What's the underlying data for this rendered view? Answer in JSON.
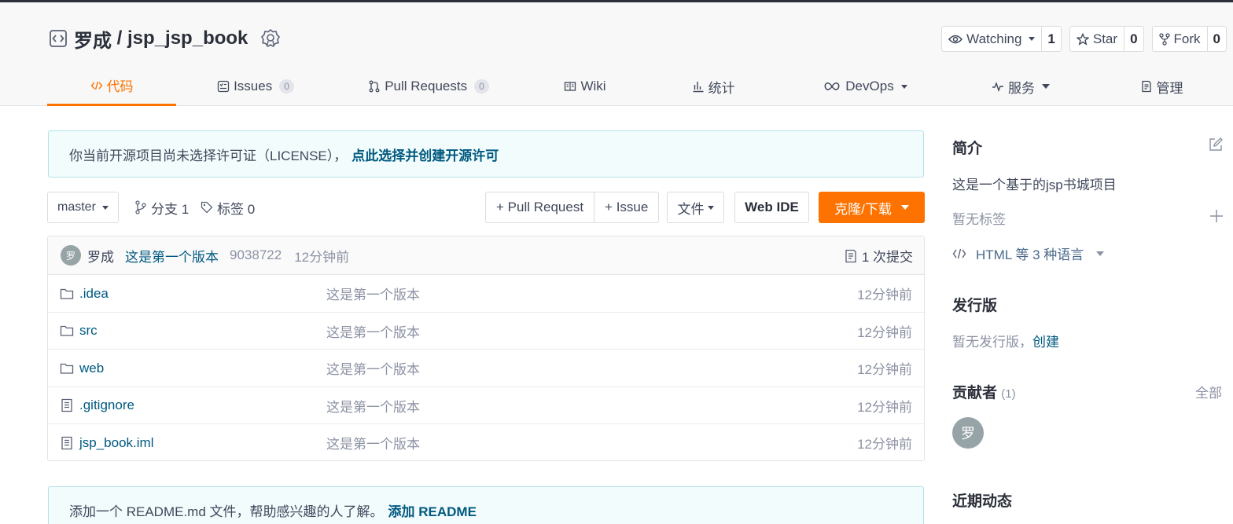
{
  "repo": {
    "owner": "罗成",
    "separator": " / ",
    "name": "jsp_jsp_book"
  },
  "header_buttons": [
    {
      "label": "Watching",
      "count": "1"
    },
    {
      "label": "Star",
      "count": "0"
    },
    {
      "label": "Fork",
      "count": "0"
    }
  ],
  "tabs": [
    {
      "label": "代码",
      "active": true
    },
    {
      "label": "Issues",
      "count": "0"
    },
    {
      "label": "Pull Requests",
      "count": "0"
    },
    {
      "label": "Wiki"
    },
    {
      "label": "统计"
    },
    {
      "label": "DevOps"
    },
    {
      "label": "服务"
    },
    {
      "label": "管理"
    }
  ],
  "license_notice": {
    "text": "你当前开源项目尚未选择许可证（LICENSE），",
    "link": "点此选择并创建开源许可"
  },
  "toolbar": {
    "branch": "master",
    "branches_label": "分支 1",
    "tags_label": "标签 0",
    "pull_request": "+ Pull Request",
    "issue": "+ Issue",
    "file": "文件",
    "web_ide": "Web IDE",
    "clone": "克隆/下载"
  },
  "commit": {
    "avatar": "罗",
    "author": "罗成",
    "message": "这是第一个版本",
    "sha": "9038722",
    "time": "12分钟前",
    "count_label": "1 次提交"
  },
  "files": [
    {
      "name": ".idea",
      "type": "folder",
      "message": "这是第一个版本",
      "time": "12分钟前"
    },
    {
      "name": "src",
      "type": "folder",
      "message": "这是第一个版本",
      "time": "12分钟前"
    },
    {
      "name": "web",
      "type": "folder",
      "message": "这是第一个版本",
      "time": "12分钟前"
    },
    {
      "name": ".gitignore",
      "type": "file",
      "message": "这是第一个版本",
      "time": "12分钟前"
    },
    {
      "name": "jsp_book.iml",
      "type": "file",
      "message": "这是第一个版本",
      "time": "12分钟前"
    }
  ],
  "readme_notice": {
    "text": "添加一个 README.md 文件，帮助感兴趣的人了解。",
    "link": "添加 README"
  },
  "sidebar": {
    "intro_title": "简介",
    "description": "这是一个基于的jsp书城项目",
    "no_tags": "暂无标签",
    "languages": "HTML 等 3 种语言",
    "releases_title": "发行版",
    "no_releases": "暂无发行版，",
    "create": "创建",
    "contributors_title": "贡献者",
    "contributors_count": "(1)",
    "all": "全部",
    "contributor_avatar": "罗",
    "activity_title": "近期动态"
  },
  "colors": {
    "accent": "#fe7300",
    "link": "#005980",
    "notice_bg": "#f2fcfc"
  }
}
